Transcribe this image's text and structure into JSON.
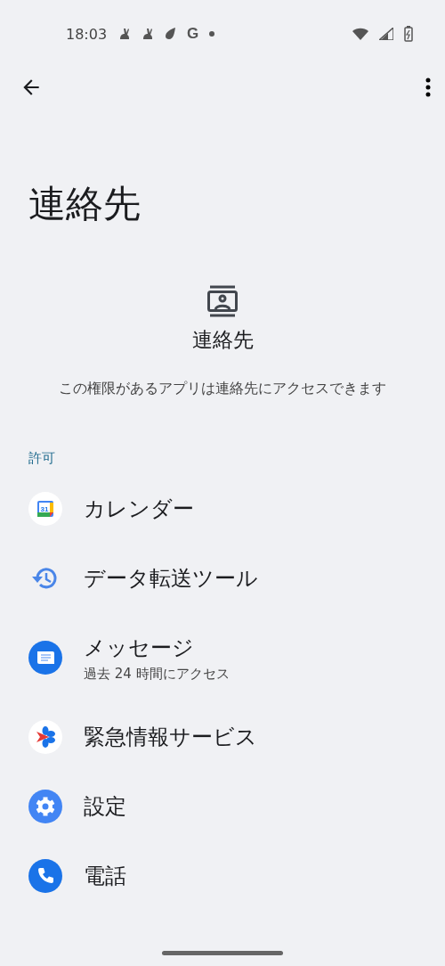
{
  "status_bar": {
    "time": "18:03",
    "g_glyph": "G"
  },
  "page": {
    "title": "連絡先"
  },
  "header": {
    "title": "連絡先",
    "description": "この権限があるアプリは連絡先にアクセスできます"
  },
  "section": {
    "label": "許可"
  },
  "apps": [
    {
      "kind": "calendar",
      "name": "カレンダー",
      "badge": "31"
    },
    {
      "kind": "history",
      "name": "データ転送ツール"
    },
    {
      "kind": "messages",
      "name": "メッセージ",
      "subtitle": "過去 24 時間にアクセス"
    },
    {
      "kind": "safety",
      "name": "緊急情報サービス"
    },
    {
      "kind": "settings",
      "name": "設定"
    },
    {
      "kind": "phone",
      "name": "電話"
    }
  ]
}
